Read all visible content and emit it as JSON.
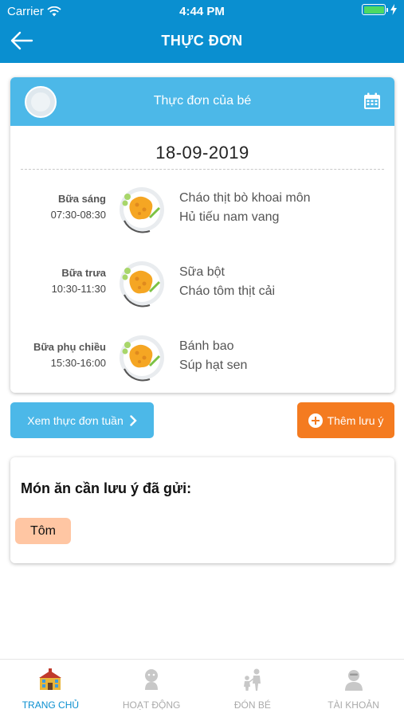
{
  "status_bar": {
    "carrier": "Carrier",
    "time": "4:44 PM"
  },
  "header": {
    "title": "THỰC ĐƠN"
  },
  "menu": {
    "card_title": "Thực đơn của bé",
    "date": "18-09-2019",
    "meals": [
      {
        "name": "Bữa sáng",
        "time": "07:30-08:30",
        "dishes": [
          "Cháo thịt bò khoai môn",
          "Hủ tiếu nam vang"
        ]
      },
      {
        "name": "Bữa trưa",
        "time": "10:30-11:30",
        "dishes": [
          "Sữa bột",
          "Cháo tôm thịt cải"
        ]
      },
      {
        "name": "Bữa phụ chiều",
        "time": "15:30-16:00",
        "dishes": [
          "Bánh bao",
          "Súp hạt sen"
        ]
      }
    ]
  },
  "actions": {
    "week_menu": "Xem thực đơn tuần",
    "add_note": "Thêm lưu ý"
  },
  "notes": {
    "title": "Món ăn cần lưu ý đã gửi:",
    "items": [
      "Tôm"
    ]
  },
  "tabbar": {
    "tabs": [
      {
        "label": "TRANG CHỦ",
        "icon": "school-icon",
        "active": true
      },
      {
        "label": "HOẠT ĐỘNG",
        "icon": "activity-icon",
        "active": false
      },
      {
        "label": "ĐÓN BÉ",
        "icon": "pickup-icon",
        "active": false
      },
      {
        "label": "TÀI KHOẢN",
        "icon": "account-icon",
        "active": false
      }
    ]
  },
  "colors": {
    "primary": "#0a8fd0",
    "card_header": "#4cb8e8",
    "accent": "#f47b20",
    "chip": "#ffc6a3"
  }
}
